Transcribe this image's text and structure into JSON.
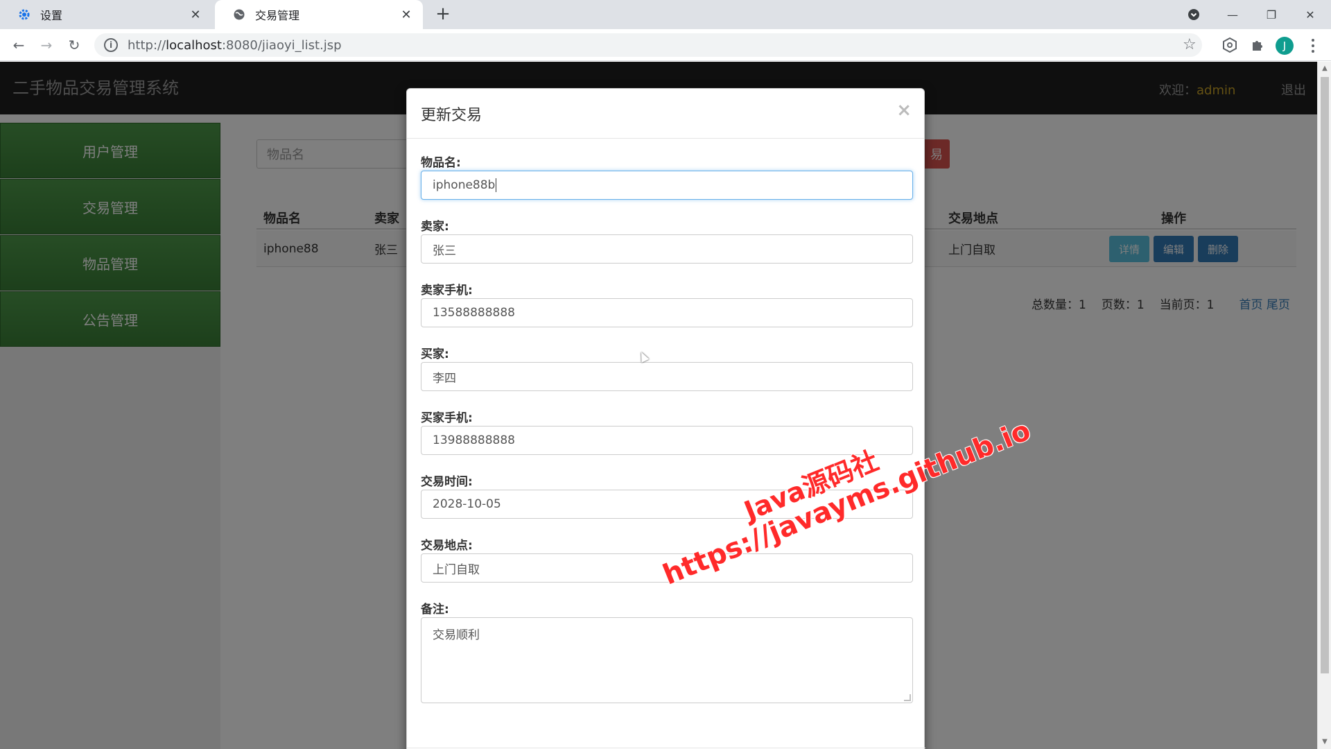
{
  "browser": {
    "tabs": [
      {
        "title": "设置",
        "icon": "gear-icon"
      },
      {
        "title": "交易管理",
        "icon": "globe-icon"
      }
    ],
    "url_prefix": "http://",
    "url_host": "localhost",
    "url_rest": ":8080/jiaoyi_list.jsp",
    "avatar_letter": "J"
  },
  "header": {
    "brand": "二手物品交易管理系统",
    "welcome_label": "欢迎：",
    "username": "admin",
    "logout": "退出"
  },
  "sidebar": {
    "items": [
      {
        "label": "用户管理"
      },
      {
        "label": "交易管理"
      },
      {
        "label": "物品管理"
      },
      {
        "label": "公告管理"
      }
    ]
  },
  "search": {
    "placeholder": "物品名",
    "button_partial": "易"
  },
  "table": {
    "headers": {
      "name": "物品名",
      "seller": "卖家",
      "location": "交易地点",
      "ops": "操作"
    },
    "row": {
      "name": "iphone88",
      "seller": "张三",
      "location": "上门自取"
    },
    "ops": {
      "detail": "详情",
      "edit": "编辑",
      "delete": "删除"
    }
  },
  "pager": {
    "total": "总数量：1",
    "pages": "页数：1",
    "current": "当前页：1",
    "first": "首页",
    "last": "尾页"
  },
  "modal": {
    "title": "更新交易",
    "close": "×",
    "fields": {
      "item_name_label": "物品名:",
      "item_name_value": "iphone88b",
      "seller_label": "卖家:",
      "seller_value": "张三",
      "seller_phone_label": "卖家手机:",
      "seller_phone_value": "13588888888",
      "buyer_label": "买家:",
      "buyer_value": "李四",
      "buyer_phone_label": "买家手机:",
      "buyer_phone_value": "13988888888",
      "time_label": "交易时间:",
      "time_value": "2028-10-05",
      "location_label": "交易地点:",
      "location_value": "上门自取",
      "note_label": "备注:",
      "note_value": "交易顺利"
    }
  },
  "watermark": {
    "line1": "Java源码社",
    "line2": "https://javayms.github.io"
  },
  "colors": {
    "sidebar_green": "#3a7f37",
    "danger": "#d9534f",
    "info": "#5bc0de",
    "primary": "#337ab7",
    "watermark": "#ff2a2a",
    "username": "#c9a227"
  }
}
